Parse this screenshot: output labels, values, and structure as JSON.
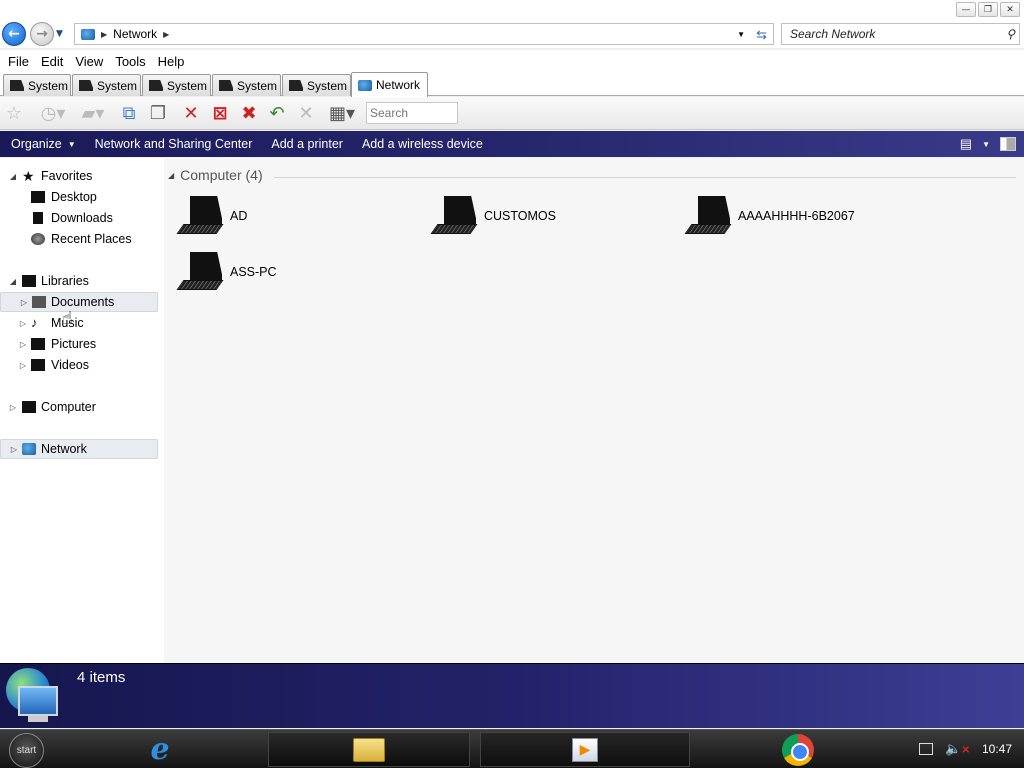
{
  "window": {
    "minimize": "—",
    "restore": "❐",
    "close": "✕"
  },
  "address": {
    "path": "Network",
    "search_placeholder": "Search Network"
  },
  "menu": [
    "File",
    "Edit",
    "View",
    "Tools",
    "Help"
  ],
  "tabs": [
    {
      "label": "System",
      "icon": "system-icon"
    },
    {
      "label": "System",
      "icon": "system-icon"
    },
    {
      "label": "System",
      "icon": "system-icon"
    },
    {
      "label": "System",
      "icon": "system-icon"
    },
    {
      "label": "System",
      "icon": "system-icon"
    },
    {
      "label": "Network",
      "icon": "network-icon",
      "active": true
    }
  ],
  "toolbar": {
    "search_placeholder": "Search"
  },
  "commands": {
    "organize": "Organize",
    "network_sharing": "Network and Sharing Center",
    "add_printer": "Add a printer",
    "add_wireless": "Add a wireless device"
  },
  "nav": {
    "favorites": "Favorites",
    "desktop": "Desktop",
    "downloads": "Downloads",
    "recent_places": "Recent Places",
    "libraries": "Libraries",
    "documents": "Documents",
    "music": "Music",
    "pictures": "Pictures",
    "videos": "Videos",
    "computer": "Computer",
    "network": "Network"
  },
  "content": {
    "group_header": "Computer (4)",
    "computers": [
      "AD",
      "CUSTOMOS",
      "AAAAHHHH-6B2067",
      "ASS-PC"
    ]
  },
  "details": {
    "item_count": "4 items"
  },
  "taskbar": {
    "start_label": "start",
    "clock": "10:47"
  },
  "colors": {
    "command_bar": "#1a1a5a",
    "details_pane": "#22226a",
    "back_button": "#1160c8"
  }
}
